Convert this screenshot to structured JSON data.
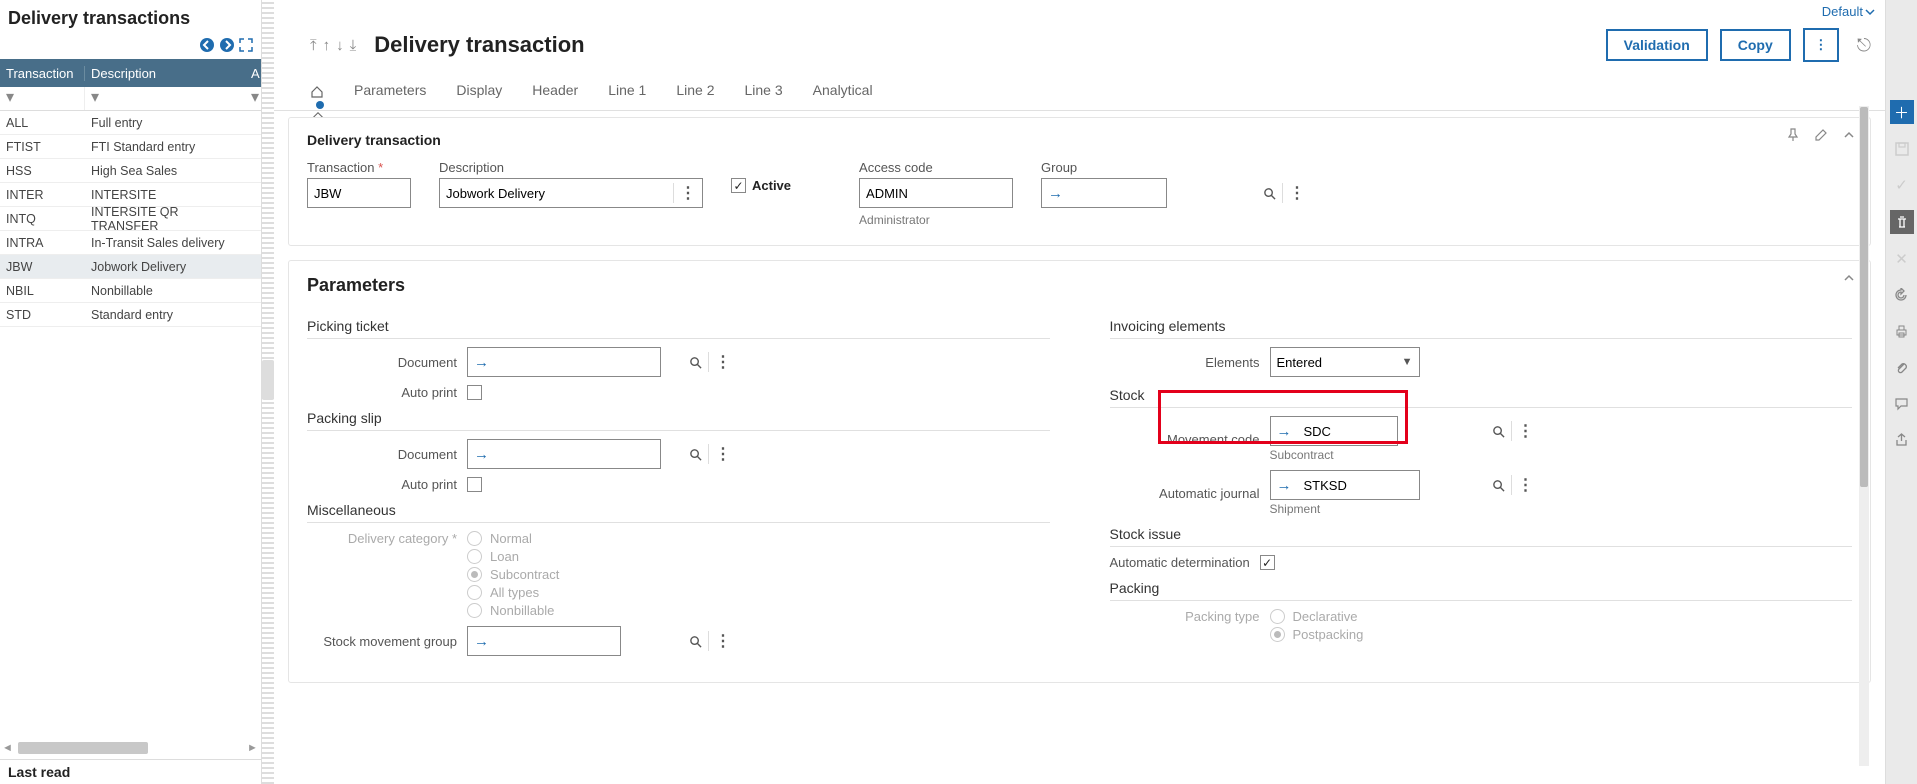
{
  "leftPanel": {
    "title": "Delivery transactions",
    "headers": {
      "col1": "Transaction",
      "col2": "Description",
      "col3": "A"
    },
    "rows": [
      {
        "code": "ALL",
        "desc": "Full entry"
      },
      {
        "code": "FTIST",
        "desc": "FTI Standard entry"
      },
      {
        "code": "HSS",
        "desc": "High Sea Sales"
      },
      {
        "code": "INTER",
        "desc": "INTERSITE"
      },
      {
        "code": "INTQ",
        "desc": "INTERSITE QR TRANSFER"
      },
      {
        "code": "INTRA",
        "desc": "In-Transit Sales delivery"
      },
      {
        "code": "JBW",
        "desc": "Jobwork Delivery",
        "selected": true
      },
      {
        "code": "NBIL",
        "desc": "Nonbillable"
      },
      {
        "code": "STD",
        "desc": "Standard entry"
      }
    ],
    "lastRead": "Last read"
  },
  "topRight": {
    "label": "Default"
  },
  "header": {
    "title": "Delivery transaction",
    "validation": "Validation",
    "copy": "Copy"
  },
  "tabs": [
    "Parameters",
    "Display",
    "Header",
    "Line 1",
    "Line 2",
    "Line 3",
    "Analytical"
  ],
  "card1": {
    "title": "Delivery transaction",
    "transactionLabel": "Transaction",
    "transactionValue": "JBW",
    "descriptionLabel": "Description",
    "descriptionValue": "Jobwork Delivery",
    "activeLabel": "Active",
    "accessLabel": "Access code",
    "accessValue": "ADMIN",
    "accessHelp": "Administrator",
    "groupLabel": "Group",
    "groupValue": ""
  },
  "params": {
    "title": "Parameters",
    "pickingTicket": "Picking ticket",
    "packingSlip": "Packing slip",
    "documentLabel": "Document",
    "autoPrintLabel": "Auto print",
    "miscellaneous": "Miscellaneous",
    "deliveryCategoryLabel": "Delivery category",
    "deliveryOptions": [
      "Normal",
      "Loan",
      "Subcontract",
      "All types",
      "Nonbillable"
    ],
    "deliverySelected": "Subcontract",
    "stockMovementGroupLabel": "Stock movement group",
    "invoicingElements": "Invoicing elements",
    "elementsLabel": "Elements",
    "elementsValue": "Entered",
    "stock": "Stock",
    "movementCodeLabel": "Movement code",
    "movementCodeValue": "SDC",
    "movementCodeHelp": "Subcontract",
    "automaticJournalLabel": "Automatic journal",
    "automaticJournalValue": "STKSD",
    "automaticJournalHelp": "Shipment",
    "stockIssue": "Stock issue",
    "autoDeterminationLabel": "Automatic determination",
    "packing": "Packing",
    "packingTypeLabel": "Packing type",
    "packingOptions": [
      "Declarative",
      "Postpacking"
    ],
    "packingSelected": "Postpacking"
  }
}
